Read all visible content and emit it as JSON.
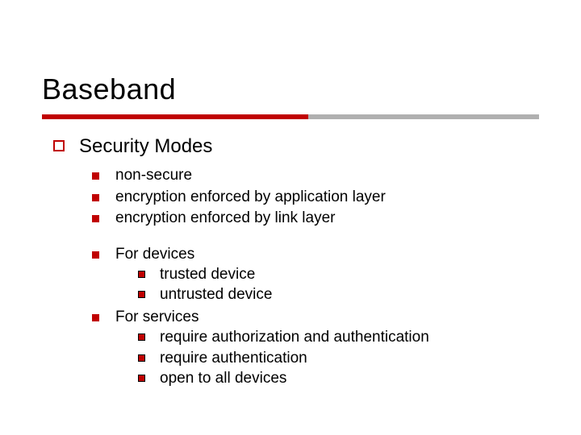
{
  "title": "Baseband",
  "section": "Security Modes",
  "modes": [
    "non-secure",
    "encryption enforced by application layer",
    "encryption enforced by link layer"
  ],
  "devices_heading": "For devices",
  "devices": [
    "trusted device",
    "untrusted device"
  ],
  "services_heading": "For services",
  "services": [
    "require authorization and authentication",
    "require authentication",
    "open to all devices"
  ]
}
